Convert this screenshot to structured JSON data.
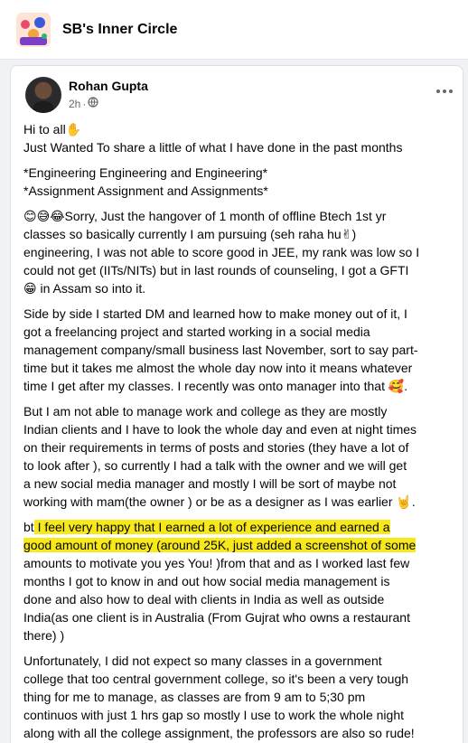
{
  "group": {
    "name": "SB's Inner Circle"
  },
  "post": {
    "author": "Rohan Gupta",
    "time": "2h",
    "privacy_dot": "·",
    "paragraphs": [
      [
        "Hi to all✋",
        "Just Wanted To share a little of what I have done in the past months"
      ],
      [
        "*Engineering Engineering and Engineering*",
        "*Assignment Assignment and Assignments*"
      ],
      [
        "😊😅😂Sorry, Just the hangover of 1 month of offline Btech 1st yr",
        "classes so basically currently I am pursuing (seh raha hu✌)",
        "engineering, I was not able to score good in JEE, my rank was low so I",
        "could not get (IITs/NITs) but in last rounds of counseling, I got a GFTI",
        "😁 in Assam so into it."
      ],
      [
        "Side by side I started DM and learned how to make money out of it, I",
        "got a freelancing project and started working in a social media",
        "management company/small business last November, sort to say part-",
        "time but it takes me almost the whole day now into it means whatever",
        "time I get after my classes. I recently was onto manager into that 🥰."
      ],
      [
        "But I am not able to manage work and college as they are mostly",
        "Indian clients and I have to look the whole day and even at night times",
        "on their requirements in terms of posts and stories (they have a lot of",
        "to look after ), so currently I had a talk with the owner and we will get",
        "a new social media manager and mostly I will be sort of maybe not",
        "working with mam(the owner ) or be as a designer as I was earlier 🤘."
      ],
      [
        "bt I feel very happy that I earned a lot of experience and earned a",
        "good amount of money (around 25K, just added a screenshot of some",
        "amounts to motivate you yes You! )from that and as I worked last few",
        "months I got to know in and out how social media management is",
        "done and also how to deal with clients in India as well as outside",
        "India(as one client is in Australia (From Gujrat who owns a restaurant",
        "there) )"
      ],
      [
        "Unfortunately, I did not expect so many classes in a government",
        "college that too central government college, so it's been a very tough",
        "thing for me to manage, as classes are from 9 am to 5;30 pm",
        "continuos with just 1 hrs gap so mostly I use to work the whole night",
        "along with all the college assignment, the professors are also so rude!"
      ]
    ],
    "highlight": {
      "color": "#f7e81a",
      "line1_plain": "bt",
      "line1_marked": " I feel very happy that I earned a lot of experience and earned a",
      "line2_marked": "good amount of money (around 25K, just added a screenshot of some"
    }
  },
  "icons": {
    "group_avatar": "group-illustration-icon",
    "privacy": "globe-icon",
    "more": "more-options-icon"
  },
  "colors": {
    "background": "#f0f2f5",
    "card": "#ffffff",
    "secondary_text": "#65676b"
  }
}
